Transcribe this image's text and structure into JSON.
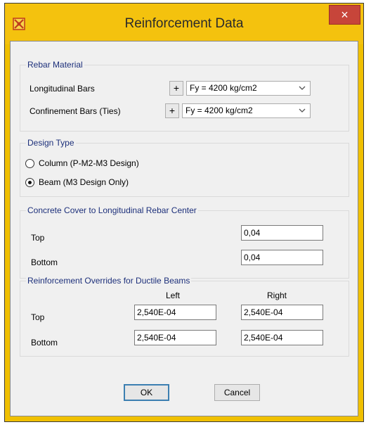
{
  "window": {
    "title": "Reinforcement Data",
    "close_label": "×"
  },
  "rebar_material": {
    "title": "Rebar Material",
    "longitudinal": {
      "label": "Longitudinal Bars",
      "add": "+",
      "value": "Fy = 4200 kg/cm2"
    },
    "confinement": {
      "label": "Confinement Bars  (Ties)",
      "add": "+",
      "value": "Fy = 4200 kg/cm2"
    }
  },
  "design_type": {
    "title": "Design Type",
    "options": [
      {
        "label": "Column  (P-M2-M3 Design)",
        "selected": false
      },
      {
        "label": "Beam  (M3 Design Only)",
        "selected": true
      }
    ]
  },
  "concrete_cover": {
    "title": "Concrete Cover to Longitudinal Rebar Center",
    "top_label": "Top",
    "top_value": "0,04",
    "bottom_label": "Bottom",
    "bottom_value": "0,04"
  },
  "overrides": {
    "title": "Reinforcement Overrides for Ductile Beams",
    "col_left": "Left",
    "col_right": "Right",
    "top_label": "Top",
    "top_left": "2,540E-04",
    "top_right": "2,540E-04",
    "bottom_label": "Bottom",
    "bottom_left": "2,540E-04",
    "bottom_right": "2,540E-04"
  },
  "buttons": {
    "ok": "OK",
    "cancel": "Cancel"
  }
}
